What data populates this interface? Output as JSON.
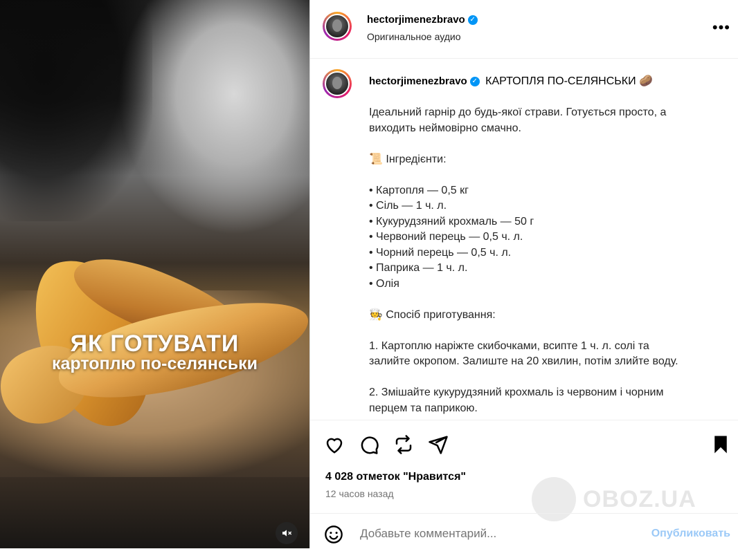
{
  "media": {
    "overlay_title": "ЯК ГОТУВАТИ",
    "overlay_subtitle": "картоплю по-селянськи",
    "mute_icon": "speaker-muted-icon"
  },
  "header": {
    "username": "hectorjimenezbravo",
    "subtitle": "Оригинальное аудио",
    "more_icon": "•••"
  },
  "caption": {
    "username": "hectorjimenezbravo",
    "title": "КАРТОПЛЯ ПО-СЕЛЯНСЬКИ 🥔",
    "lines": [
      "Ідеальний гарнір до будь-якої страви. Готується просто, а",
      "виходить неймовірно смачно.",
      "",
      "📜 Інгредієнти:",
      "",
      "• Картопля — 0,5 кг",
      "• Сіль — 1 ч. л.",
      "• Кукурудзяний крохмаль — 50 г",
      "• Червоний перець — 0,5 ч. л.",
      "• Чорний перець — 0,5 ч. л.",
      "• Паприка — 1 ч. л.",
      "• Олія",
      "",
      "🧑‍🍳 Спосіб приготування:",
      "",
      "1. Картоплю наріжте скибочками, всипте 1 ч. л. солі та",
      "залийте окропом. Залиште на 20 хвилин, потім злийте воду.",
      "",
      "2. Змішайте кукурудзяний крохмаль із червоним і чорним",
      "перцем та паприкою."
    ]
  },
  "actions": {
    "icons": [
      "heart-icon",
      "comment-icon",
      "repost-icon",
      "share-icon",
      "bookmark-icon"
    ]
  },
  "likes": "4 028 отметок \"Нравится\"",
  "time": "12 часов назад",
  "comment": {
    "placeholder": "Добавьте комментарий...",
    "publish": "Опубликовать"
  },
  "watermark": "OBOZ.UA"
}
